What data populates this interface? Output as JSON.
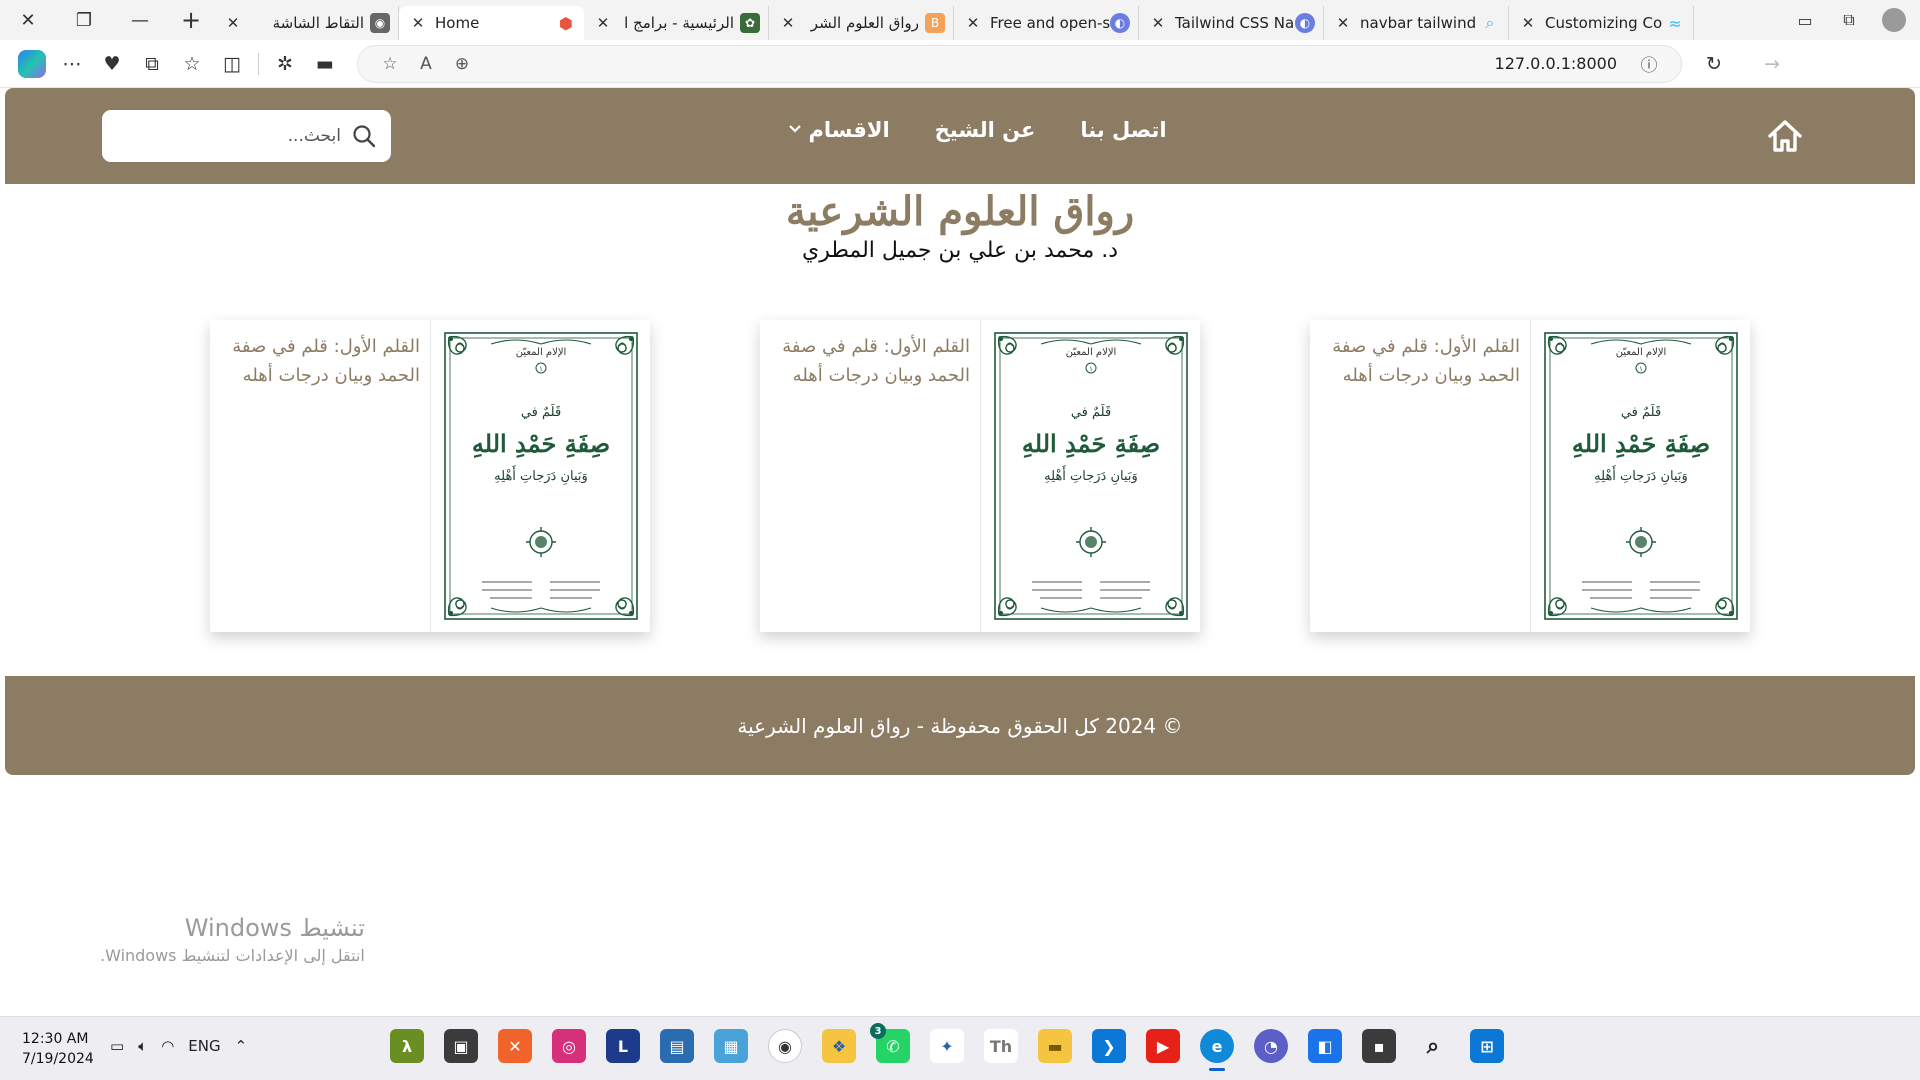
{
  "browser": {
    "tabs": [
      {
        "title": "التقاط الشاشة",
        "favicon": "snip-icon",
        "color": "#666666"
      },
      {
        "title": "Home",
        "favicon": "laravel-icon",
        "color": "#e8553f",
        "active": true
      },
      {
        "title": "الرئيسية - برامج ا",
        "favicon": "ornament-icon",
        "color": "#3a6b3a"
      },
      {
        "title": "رواق العلوم الشر",
        "favicon": "blogger-icon",
        "color": "#f4a259"
      },
      {
        "title": "Free and open-s",
        "favicon": "globe-icon",
        "color": "#6b7de0"
      },
      {
        "title": "Tailwind CSS Na",
        "favicon": "globe-icon",
        "color": "#6b7de0"
      },
      {
        "title": "navbar tailwind",
        "favicon": "search-icon",
        "color": "#6aa6e8"
      },
      {
        "title": "Customizing Co",
        "favicon": "tailwind-icon",
        "color": "#38bdf8"
      }
    ],
    "url": "127.0.0.1:8000"
  },
  "nav": {
    "links": [
      {
        "label": "اتصل بنا"
      },
      {
        "label": "عن الشيخ"
      },
      {
        "label": "الاقسام",
        "dropdown": true
      }
    ],
    "search_placeholder": "ابحث..."
  },
  "site": {
    "title": "رواق العلوم الشرعية",
    "author": "د. محمد بن علي بن جميل المطري"
  },
  "cards": [
    {
      "text": "القلم الأول: قلم في صفة الحمد وبيان درجات أهله"
    },
    {
      "text": "القلم الأول: قلم في صفة الحمد وبيان درجات أهله"
    },
    {
      "text": "القلم الأول: قلم في صفة الحمد وبيان درجات أهله"
    }
  ],
  "book_cover": {
    "series": "الإلام المعيّن",
    "number": "١",
    "top_line": "قَلَمٌ في",
    "main_line": "صِفَةِ حَمْدِ اللهِ",
    "sub_line": "وَبَيانِ دَرَجاتِ أَهْلِهِ"
  },
  "footer": {
    "text": "© 2024 كل الحقوق محفوظة - رواق العلوم الشرعية"
  },
  "watermark": {
    "title": "تنشيط Windows",
    "subtitle": "انتقل إلى الإعدادات لتنشيط Windows."
  },
  "taskbar": {
    "time": "12:30 AM",
    "date": "7/19/2024",
    "lang": "ENG",
    "whatsapp_badge": "3"
  },
  "colors": {
    "brand": "#8d7c64",
    "cover_green": "#1f5a3a"
  }
}
